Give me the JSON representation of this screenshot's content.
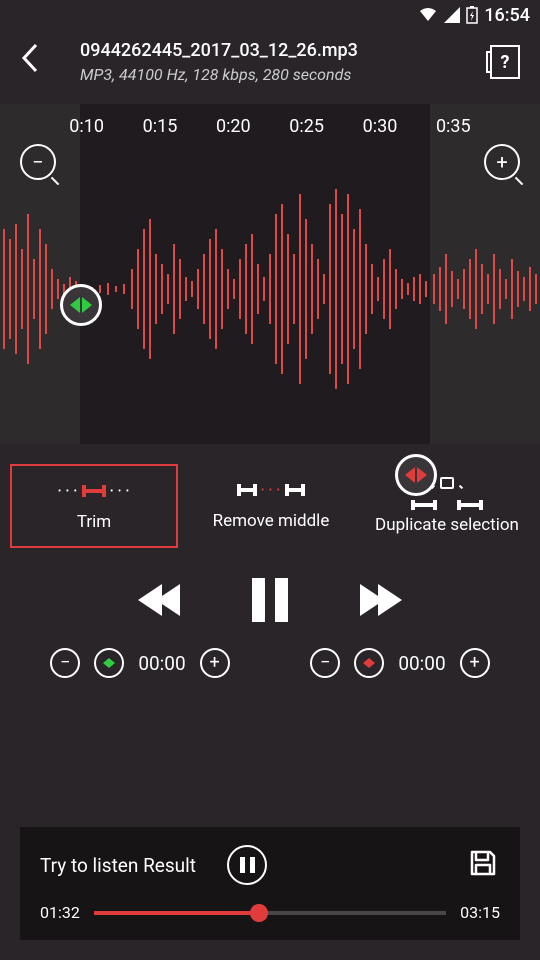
{
  "status": {
    "time": "16:54"
  },
  "header": {
    "file_name": "0944262445_2017_03_12_26.mp3",
    "file_meta": "MP3, 44100 Hz, 128 kbps, 280 seconds"
  },
  "ruler": [
    "0:10",
    "0:15",
    "0:20",
    "0:25",
    "0:30",
    "0:35"
  ],
  "tools": {
    "trim": "Trim",
    "remove": "Remove middle",
    "duplicate": "Duplicate selection"
  },
  "time_controls": {
    "left_time": "00:00",
    "right_time": "00:00"
  },
  "result": {
    "label": "Try to listen Result",
    "current": "01:32",
    "total": "03:15"
  }
}
